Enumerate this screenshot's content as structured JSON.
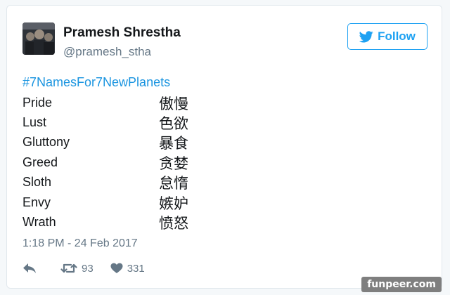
{
  "tweet": {
    "display_name": "Pramesh Shrestha",
    "handle": "@pramesh_stha",
    "follow_label": "Follow",
    "hashtag": "#7NamesFor7NewPlanets",
    "pairs": [
      {
        "en": "Pride",
        "zh": "傲慢"
      },
      {
        "en": "Lust",
        "zh": "色欲"
      },
      {
        "en": "Gluttony",
        "zh": "暴食"
      },
      {
        "en": "Greed",
        "zh": "贪婪"
      },
      {
        "en": "Sloth",
        "zh": "怠惰"
      },
      {
        "en": "Envy",
        "zh": "嫉妒"
      },
      {
        "en": "Wrath",
        "zh": "愤怒"
      }
    ],
    "timestamp": "1:18 PM - 24 Feb 2017",
    "retweet_count": "93",
    "like_count": "331"
  },
  "watermark": "funpeer.com",
  "colors": {
    "accent": "#1da1f2",
    "link": "#1b95e0",
    "muted": "#657786",
    "text": "#14171a",
    "border": "#e1e8ed"
  },
  "icons": [
    "twitter-bird-icon",
    "reply-icon",
    "retweet-icon",
    "heart-icon"
  ]
}
